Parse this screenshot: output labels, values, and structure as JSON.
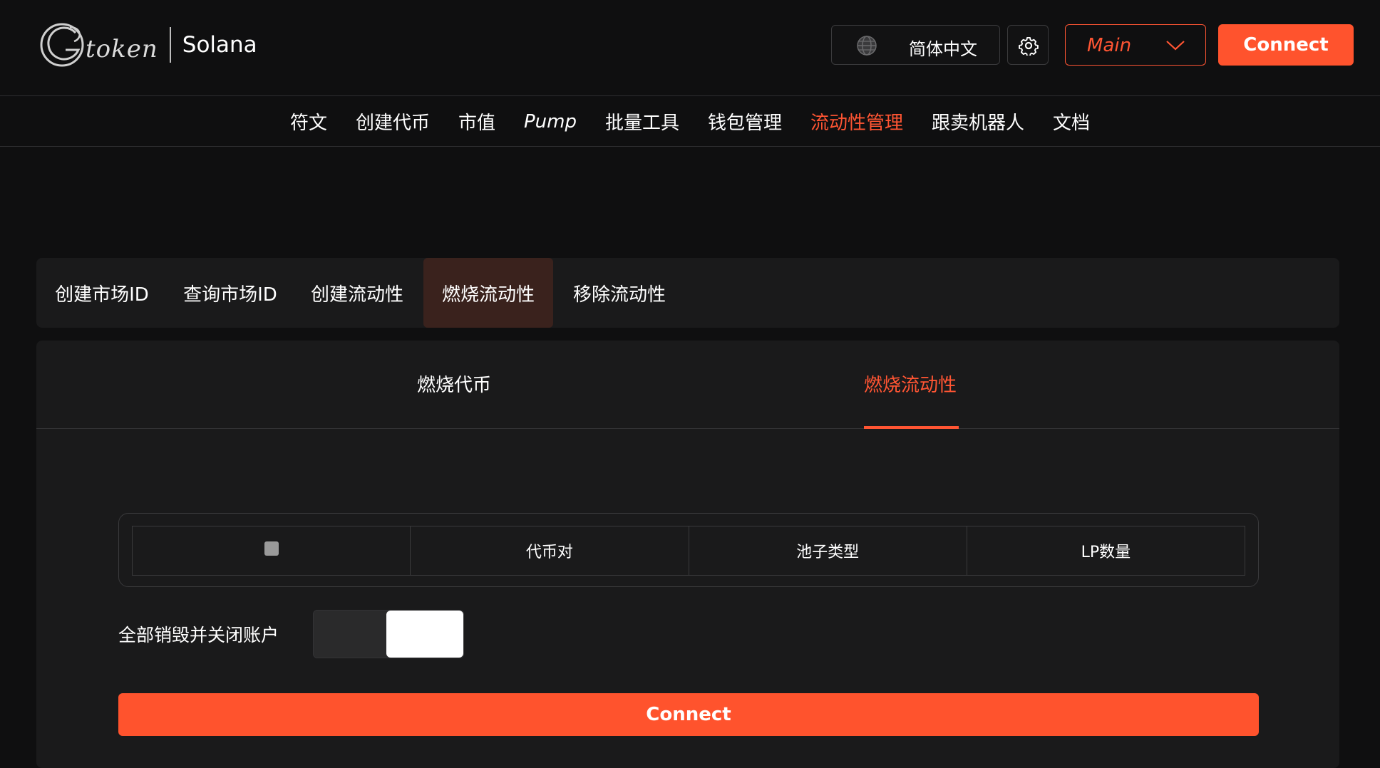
{
  "header": {
    "logo_text": "token",
    "chain": "Solana",
    "language": "简体中文",
    "network": "Main",
    "connect_label": "Connect"
  },
  "nav": {
    "items": [
      "符文",
      "创建代币",
      "市值",
      "Pump",
      "批量工具",
      "钱包管理",
      "流动性管理",
      "跟卖机器人",
      "文档"
    ],
    "active": "流动性管理"
  },
  "tabs": {
    "items": [
      "创建市场ID",
      "查询市场ID",
      "创建流动性",
      "燃烧流动性",
      "移除流动性"
    ],
    "active": "燃烧流动性"
  },
  "subtabs": {
    "items": [
      "燃烧代币",
      "燃烧流动性"
    ],
    "active": "燃烧流动性"
  },
  "table": {
    "columns": [
      "",
      "代币对",
      "池子类型",
      "LP数量"
    ]
  },
  "toggle": {
    "label": "全部销毁并关闭账户",
    "on": false
  },
  "main": {
    "connect_label": "Connect"
  },
  "colors": {
    "accent": "#ff532d",
    "background": "#0f0f10",
    "panel": "#1a1a1b",
    "active_tab_bg": "#3a221d"
  }
}
